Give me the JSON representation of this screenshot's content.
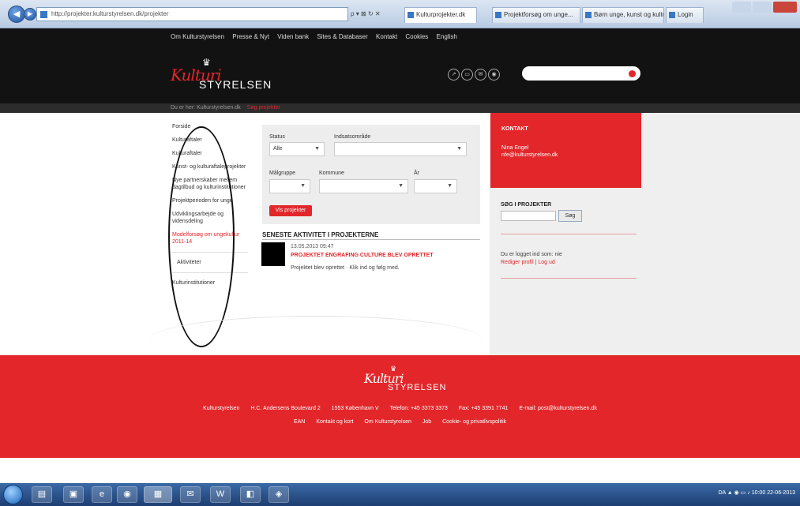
{
  "browser": {
    "url": "http://projekter.kulturstyrelsen.dk/projekter",
    "tabs": [
      {
        "label": "Kulturprojekter.dk"
      },
      {
        "label": "Projektforsøg om unge..."
      },
      {
        "label": "Børn unge, kunst og kultur"
      },
      {
        "label": "Login"
      }
    ]
  },
  "site": {
    "topnav": [
      "Om Kulturstyrelsen",
      "Presse & Nyt",
      "Viden bank",
      "Sites & Databaser",
      "Kontakt",
      "Cookies",
      "English"
    ],
    "logo_script": "Kulturi",
    "logo_word": "STYRELSEN",
    "breadcrumb": {
      "home": "Du er her: Kulturstyrelsen.dk",
      "current": "Søg projekter"
    }
  },
  "sidebar": {
    "items": [
      {
        "label": "Forside"
      },
      {
        "label": "Kulturaftaler"
      },
      {
        "label": "Kulturaftaler"
      },
      {
        "label": "Kunst- og kulturaftaleprojekter"
      },
      {
        "label": "Nye partnerskaber mellem dagtilbud og kulturinstitutioner"
      },
      {
        "label": "Projektperioden for unge"
      },
      {
        "label": "Udviklingsarbejde og vidensdeling"
      },
      {
        "label": "Modelforsøg om ungekultur 2011-14"
      },
      {
        "label": "Aktiviteter"
      },
      {
        "label": "Kulturinstitutioner"
      }
    ]
  },
  "filter": {
    "status_label": "Status",
    "status_value": "Alle",
    "area_label": "Indsatsområde",
    "area_value": "",
    "target_label": "Målgruppe",
    "municipality_label": "Kommune",
    "year_label": "År",
    "button": "Vis projekter"
  },
  "activity": {
    "title": "SENESTE AKTIVITET I PROJEKTERNE",
    "date": "13.05.2013 09:47",
    "headline": "PROJEKTET ENGRAFING CULTURE BLEV OPRETTET",
    "text": "Projektet blev oprettet · Klik ind og følg med."
  },
  "right": {
    "contact_title": "KONTAKT",
    "contact_name": "Nina Engel",
    "contact_email": "nfe@kulturstyrelsen.dk",
    "search_title": "SØG I PROJEKTER",
    "search_button": "Søg",
    "login_text": "Du er logget ind som: nie",
    "login_links": "Rediger profil | Log ud"
  },
  "footer": {
    "logo_script": "Kulturi",
    "logo_word": "STYRELSEN",
    "line1": [
      "Kulturstyrelsen",
      "H.C. Andersens Boulevard 2",
      "1553 København V",
      "Telefon: +45 3373 3373",
      "Fax: +45 3391 7741",
      "E-mail: post@kulturstyrelsen.dk"
    ],
    "line2": [
      "EAN",
      "Kontakt og kort",
      "Om Kulturstyrelsen",
      "Job",
      "Cookie- og privatlivspolitik"
    ]
  },
  "taskbar": {
    "tray_text": "DA",
    "time": "10:00",
    "date": "22-06-2013"
  },
  "colors": {
    "brand_red": "#e2262a",
    "header_black": "#121212"
  }
}
